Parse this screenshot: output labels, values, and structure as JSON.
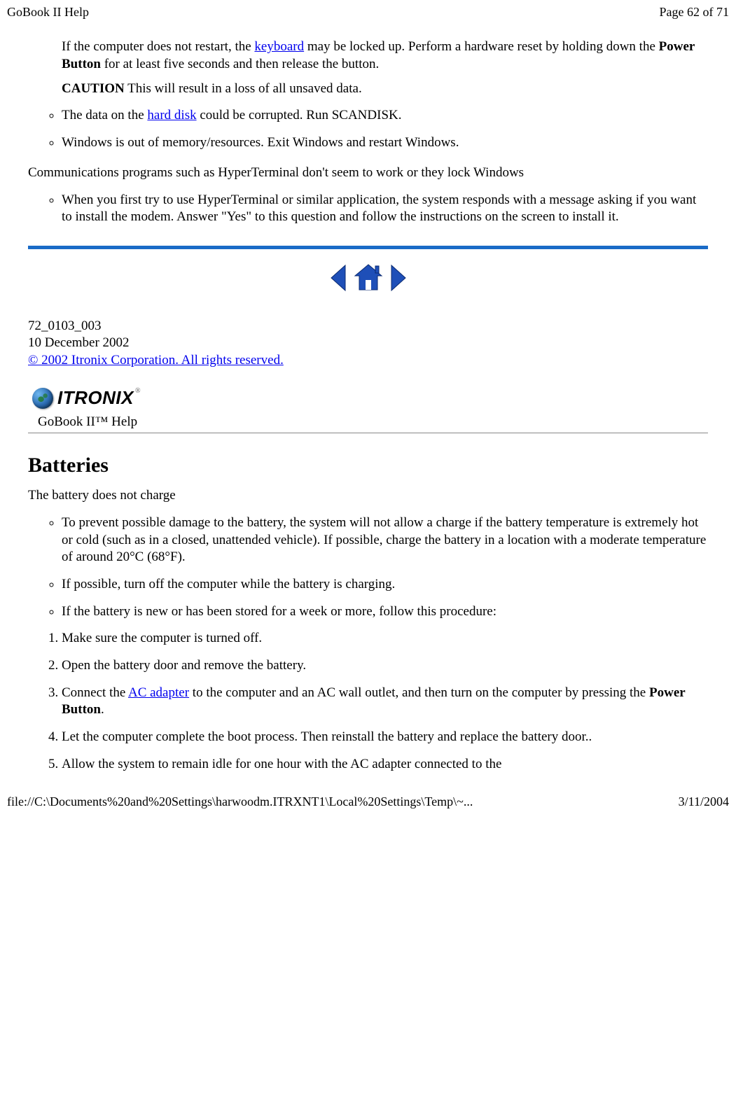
{
  "header": {
    "left": "GoBook II Help",
    "right": "Page 62 of 71"
  },
  "footer": {
    "left": "file://C:\\Documents%20and%20Settings\\harwoodm.ITRXNT1\\Local%20Settings\\Temp\\~...",
    "right": "3/11/2004"
  },
  "intro": {
    "p1_before": "If the computer does not restart, the ",
    "p1_link": "keyboard",
    "p1_after_before_bold": " may be locked up. Perform a hardware reset by holding down the ",
    "p1_bold": "Power Button",
    "p1_after_bold": " for at least five seconds and then release the button.",
    "caution_label": "CAUTION",
    "caution_text": " This will result in a loss of all unsaved data."
  },
  "list1": {
    "item1_before": "The data on the ",
    "item1_link": "hard disk",
    "item1_after": " could be corrupted.  Run SCANDISK.",
    "item2": "Windows is out of memory/resources. Exit Windows and restart Windows."
  },
  "para2": "Communications programs such as HyperTerminal don't seem to work or they lock Windows",
  "list2": {
    "item1": "When you first try to use HyperTerminal or similar application, the system responds with a message asking if you want to install the modem. Answer \"Yes\" to this question and follow the instructions on the screen to install it."
  },
  "doc_meta": {
    "line1": "72_0103_003",
    "line2": "10 December 2002",
    "copyright": "© 2002 Itronix Corporation.  All rights reserved."
  },
  "brand": {
    "name": "ITRONIX",
    "subtitle": "GoBook II™ Help"
  },
  "section2": {
    "heading": "Batteries",
    "para": "The battery does not charge",
    "ul": {
      "i1": "To prevent possible damage to the battery, the system will not allow a charge if the battery temperature is extremely hot or cold (such as in a closed, unattended vehicle). If possible, charge the battery in a location with a moderate temperature of around 20°C (68°F).",
      "i2": "If possible, turn off the computer while the battery is charging.",
      "i3": "If the battery is new or has been stored for a week or more, follow this procedure:"
    },
    "ol": {
      "i1": "Make sure the computer is turned off.",
      "i2": "Open the battery door and remove the battery.",
      "i3_before": "Connect the ",
      "i3_link": "AC adapter",
      "i3_after_before_bold": " to the computer and an AC wall outlet, and then turn on the computer by pressing the ",
      "i3_bold": "Power Button",
      "i3_after_bold": ".",
      "i4": "Let the computer complete the boot process.  Then reinstall the battery and replace the battery door..",
      "i5": "Allow the system to remain idle for one hour with the AC adapter connected to the"
    }
  }
}
